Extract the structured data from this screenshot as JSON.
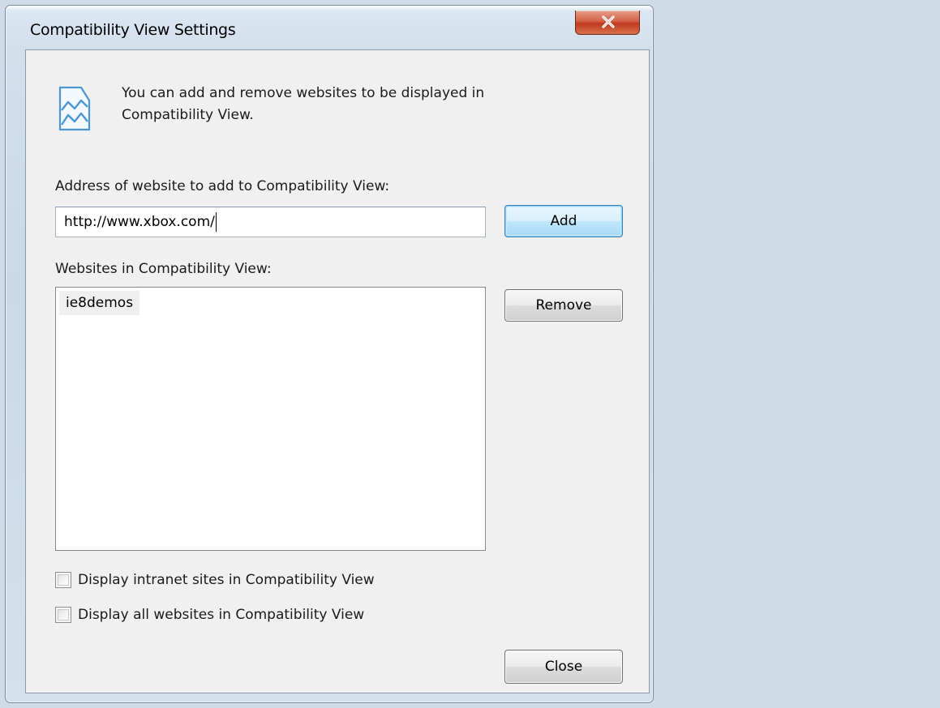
{
  "window": {
    "title": "Compatibility View Settings"
  },
  "info": {
    "icon": "compatibility-view-icon",
    "text": "You can add and remove websites to be displayed in Compatibility View."
  },
  "address": {
    "label": "Address of website to add to Compatibility View:",
    "value": "http://www.xbox.com/"
  },
  "buttons": {
    "add": "Add",
    "remove": "Remove",
    "close": "Close"
  },
  "websites": {
    "label": "Websites in Compatibility View:",
    "items": [
      "ie8demos"
    ]
  },
  "options": {
    "intranet": {
      "label": "Display intranet sites in Compatibility View",
      "checked": false
    },
    "all": {
      "label": "Display all websites in Compatibility View",
      "checked": false
    }
  },
  "colors": {
    "desktop_background": "#cfdce6",
    "dialog_background": "#f0f0f0",
    "close_button_red": "#c0391f",
    "default_button_blue": "#3c7fb1"
  }
}
